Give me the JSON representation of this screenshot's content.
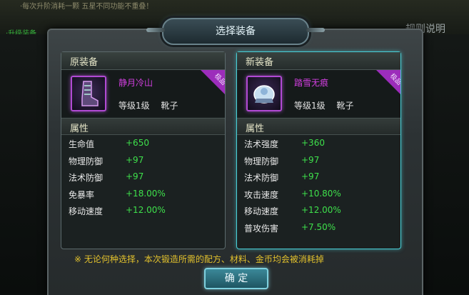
{
  "background": {
    "top_text": "·每次升阶消耗一颗 五星不同功能不重叠！",
    "left_text": "·升级装备",
    "right_text": "规则说明"
  },
  "dialog": {
    "title": "选择装备",
    "notice": "※ 无论何种选择，本次锻造所需的配方、材料、金币均会被消耗掉",
    "confirm_label": "确 定"
  },
  "original": {
    "header": "原装备",
    "item_name": "静月冷山",
    "level": "等级1级",
    "type": "靴子",
    "ribbon": "极品",
    "attr_header": "属性",
    "attributes": [
      {
        "name": "生命值",
        "value": "+650"
      },
      {
        "name": "物理防御",
        "value": "+97"
      },
      {
        "name": "法术防御",
        "value": "+97"
      },
      {
        "name": "免暴率",
        "value": "+18.00%"
      },
      {
        "name": "移动速度",
        "value": "+12.00%"
      }
    ]
  },
  "new": {
    "header": "新装备",
    "item_name": "踏雪无痕",
    "level": "等级1级",
    "type": "靴子",
    "ribbon": "极品",
    "attr_header": "属性",
    "attributes": [
      {
        "name": "法术强度",
        "value": "+360"
      },
      {
        "name": "物理防御",
        "value": "+97"
      },
      {
        "name": "法术防御",
        "value": "+97"
      },
      {
        "name": "攻击速度",
        "value": "+10.80%"
      },
      {
        "name": "移动速度",
        "value": "+12.00%"
      },
      {
        "name": "普攻伤害",
        "value": "+7.50%"
      }
    ]
  }
}
